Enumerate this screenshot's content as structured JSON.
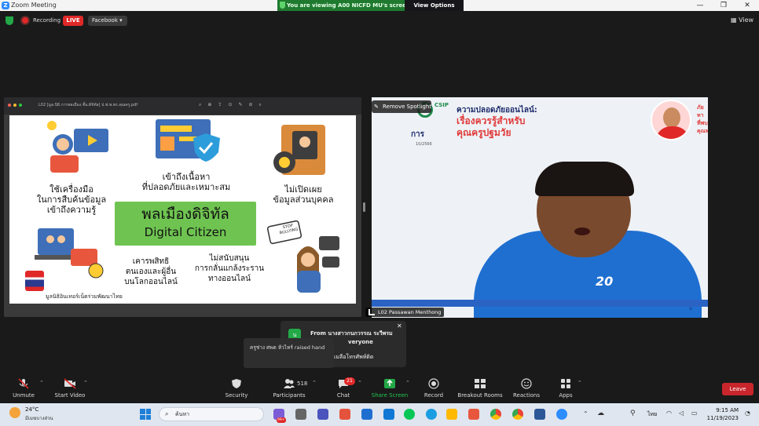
{
  "window": {
    "title": "Zoom Meeting"
  },
  "banner": {
    "message": "You are viewing A00 NICFD MU's screen",
    "view_options": "View Options"
  },
  "status": {
    "recording": "Recording",
    "live": "LIVE",
    "facebook": "Facebook",
    "view": "View"
  },
  "shared": {
    "pdf_title": "L02 [มูล.นิธิ.การพลเมือง.ชั้น.ดิจิทัล] ป.ฟ.พ.พร.คุณครู.pdf",
    "slide": {
      "top_center": [
        "เข้าถึงเนื้อหา",
        "ที่ปลอดภัยและเหมาะสม"
      ],
      "left_mid": [
        "ใช้เครื่องมือ",
        "ในการสืบค้นข้อมูล",
        "เข้าถึงความรู้"
      ],
      "right_mid": [
        "ไม่เปิดเผย",
        "ข้อมูลส่วนบุคคล"
      ],
      "main_th": "พลเมืองดิจิทัล",
      "main_en": "Digital Citizen",
      "bottom_left": [
        "เคารพสิทธิ",
        "ตนเองและผู้อื่น",
        "บนโลกออนไลน์"
      ],
      "bottom_right": [
        "ไม่สนับสนุน",
        "การกลั่นแกล้งระราน",
        "ทางออนไลน์"
      ],
      "footer": "มูลนิธิอินเทอร์เน็ตร่วมพัฒนาไทย",
      "stop_sign": "STOP BULLYING"
    }
  },
  "video": {
    "remove_spotlight": "Remove Spotlight",
    "csip": "CSIP",
    "header_line1": "ความปลอดภัยออนไลน์:",
    "header_line2": "เรื่องควรรู้สำหรับ",
    "header_line3": "คุณครูปฐมวัย",
    "partial": "การ",
    "date": "10/2566",
    "right_partial1": "ภัยทา",
    "right_partial2": "ที่พบ",
    "right_partial3": "คุณท",
    "name_label": "L02 Passawan Menthong",
    "shirt_text": "20",
    "corner_text": "บ"
  },
  "chat_popup": {
    "from": "From นางสาวกนกวรรณ ระวีพรม",
    "to": "veryone",
    "text": "เมลือโทรศัพท์ติด"
  },
  "raised_hand": {
    "text": "ครูช่าง ศพด ห้วไหร์ raised hand"
  },
  "toolbar": {
    "unmute": "Unmute",
    "start_video": "Start Video",
    "security": "Security",
    "participants": "Participants",
    "participants_count": "518",
    "chat": "Chat",
    "chat_badge": "21",
    "share": "Share Screen",
    "record": "Record",
    "breakout": "Breakout Rooms",
    "reactions": "Reactions",
    "apps": "Apps",
    "leave": "Leave"
  },
  "taskbar": {
    "temp": "24°C",
    "weather": "มีเมฆบางส่วน",
    "search": "ค้นหา",
    "lang": "ไทย",
    "time": "9:15 AM",
    "date": "11/19/2023",
    "badge": "99+"
  },
  "colors": {
    "accent_green": "#23a847",
    "live_red": "#e02828",
    "leave_red": "#c8262c",
    "citizen_green": "#6fc451"
  }
}
